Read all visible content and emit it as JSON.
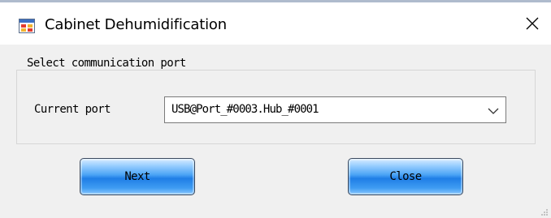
{
  "window": {
    "title": "Cabinet Dehumidification",
    "icon": "app-window-icon",
    "close_icon": "close-icon"
  },
  "group": {
    "legend": "Select communication port",
    "port_label": "Current port",
    "port_select": {
      "value": "USB@Port_#0003.Hub_#0001",
      "icon": "chevron-down-icon"
    }
  },
  "buttons": {
    "next_label": "Next",
    "close_label": "Close"
  },
  "colors": {
    "button_accent": "#2f8ef0",
    "titlebar": "#ffffff",
    "window_bg": "#f0f0f0"
  }
}
